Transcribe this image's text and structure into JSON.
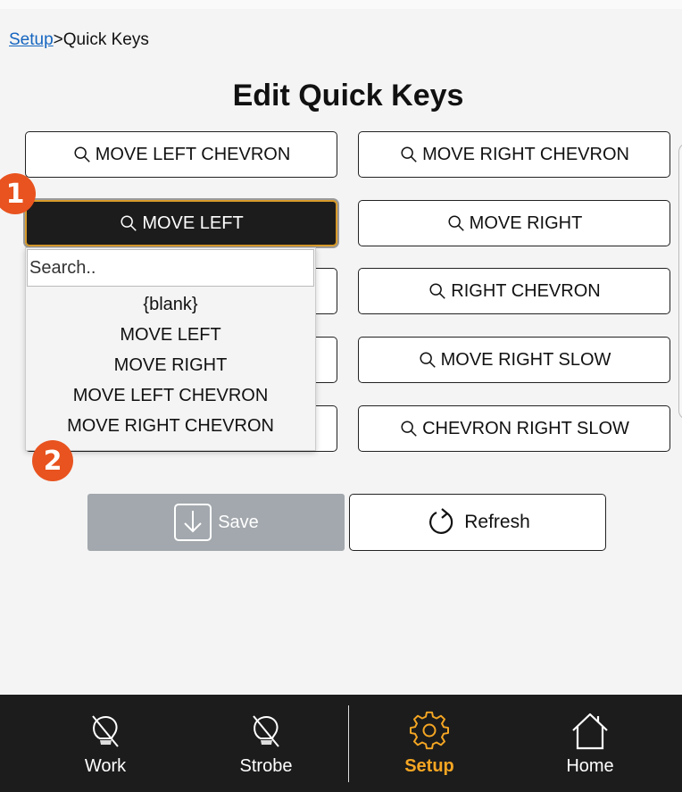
{
  "breadcrumb": {
    "parent": "Setup",
    "separator": ">",
    "current": "Quick Keys"
  },
  "title": "Edit Quick Keys",
  "quick_keys": {
    "row1_left": "MOVE LEFT CHEVRON",
    "row1_right": "MOVE RIGHT CHEVRON",
    "row2_left": "MOVE LEFT",
    "row2_right": "MOVE RIGHT",
    "row3_right": "RIGHT CHEVRON",
    "row4_right": "MOVE RIGHT SLOW",
    "row5_right": "CHEVRON RIGHT SLOW"
  },
  "dropdown": {
    "placeholder": "Search..",
    "options": [
      "{blank}",
      "MOVE LEFT",
      "MOVE RIGHT",
      "MOVE LEFT CHEVRON",
      "MOVE RIGHT CHEVRON"
    ]
  },
  "badges": {
    "first": "1",
    "second": "2"
  },
  "actions": {
    "save_label": "Save",
    "refresh_label": "Refresh"
  },
  "nav": {
    "work": "Work",
    "strobe": "Strobe",
    "setup": "Setup",
    "home": "Home"
  },
  "colors": {
    "accent": "#f5a623",
    "badge": "#e8531f",
    "link": "#1565c0",
    "nav_bg": "#1c1c1c",
    "save_disabled": "#a2a8ad"
  },
  "icons": {
    "search": "search-icon",
    "save": "save-icon",
    "refresh": "refresh-icon",
    "work": "bulb-off-icon",
    "strobe": "bulb-off-icon",
    "setup": "gear-icon",
    "home": "home-icon"
  }
}
